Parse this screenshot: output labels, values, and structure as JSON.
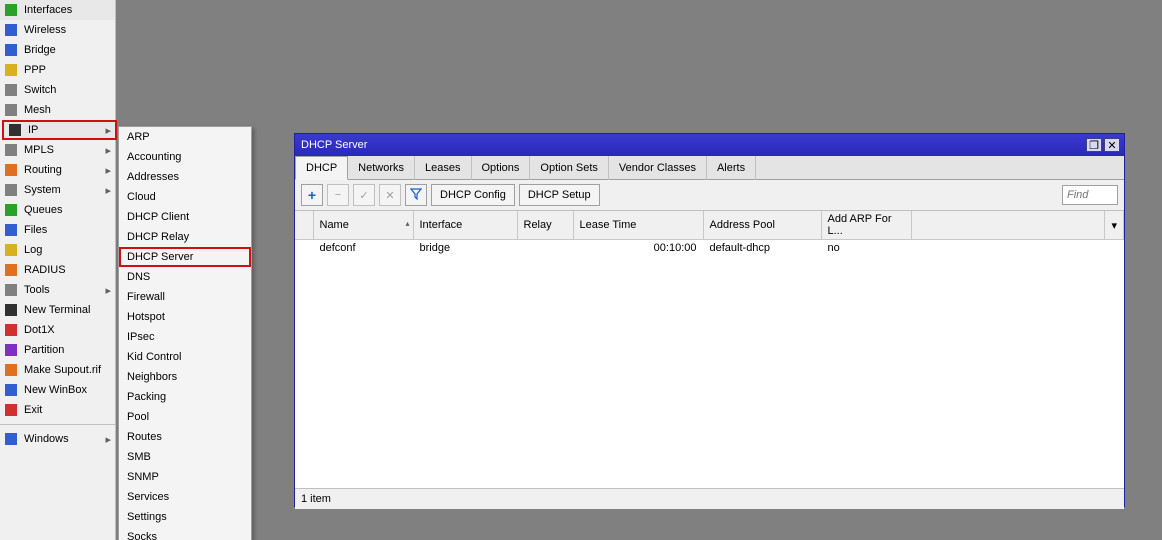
{
  "sidebar": {
    "items": [
      {
        "label": "Interfaces",
        "icon": "interfaces-icon",
        "color": "ic-green",
        "arrow": false
      },
      {
        "label": "Wireless",
        "icon": "wireless-icon",
        "color": "ic-blue",
        "arrow": false
      },
      {
        "label": "Bridge",
        "icon": "bridge-icon",
        "color": "ic-blue",
        "arrow": false
      },
      {
        "label": "PPP",
        "icon": "ppp-icon",
        "color": "ic-yellow",
        "arrow": false
      },
      {
        "label": "Switch",
        "icon": "switch-icon",
        "color": "ic-gray",
        "arrow": false
      },
      {
        "label": "Mesh",
        "icon": "mesh-icon",
        "color": "ic-gray",
        "arrow": false
      },
      {
        "label": "IP",
        "icon": "ip-icon",
        "color": "ic-black",
        "arrow": true,
        "highlighted": true,
        "selected": true
      },
      {
        "label": "MPLS",
        "icon": "mpls-icon",
        "color": "ic-gray",
        "arrow": true
      },
      {
        "label": "Routing",
        "icon": "routing-icon",
        "color": "ic-orange",
        "arrow": true
      },
      {
        "label": "System",
        "icon": "system-icon",
        "color": "ic-gray",
        "arrow": true
      },
      {
        "label": "Queues",
        "icon": "queues-icon",
        "color": "ic-green",
        "arrow": false
      },
      {
        "label": "Files",
        "icon": "files-icon",
        "color": "ic-blue",
        "arrow": false
      },
      {
        "label": "Log",
        "icon": "log-icon",
        "color": "ic-yellow",
        "arrow": false
      },
      {
        "label": "RADIUS",
        "icon": "radius-icon",
        "color": "ic-orange",
        "arrow": false
      },
      {
        "label": "Tools",
        "icon": "tools-icon",
        "color": "ic-gray",
        "arrow": true
      },
      {
        "label": "New Terminal",
        "icon": "new-terminal-icon",
        "color": "ic-black",
        "arrow": false
      },
      {
        "label": "Dot1X",
        "icon": "dot1x-icon",
        "color": "ic-red",
        "arrow": false
      },
      {
        "label": "Partition",
        "icon": "partition-icon",
        "color": "ic-purple",
        "arrow": false
      },
      {
        "label": "Make Supout.rif",
        "icon": "supout-icon",
        "color": "ic-orange",
        "arrow": false
      },
      {
        "label": "New WinBox",
        "icon": "new-winbox-icon",
        "color": "ic-blue",
        "arrow": false
      },
      {
        "label": "Exit",
        "icon": "exit-icon",
        "color": "ic-red",
        "arrow": false
      }
    ],
    "divider_after": 20,
    "windows_label": "Windows",
    "windows_icon": "windows-icon"
  },
  "submenu": {
    "items": [
      {
        "label": "ARP"
      },
      {
        "label": "Accounting"
      },
      {
        "label": "Addresses"
      },
      {
        "label": "Cloud"
      },
      {
        "label": "DHCP Client"
      },
      {
        "label": "DHCP Relay"
      },
      {
        "label": "DHCP Server",
        "highlighted": true
      },
      {
        "label": "DNS"
      },
      {
        "label": "Firewall"
      },
      {
        "label": "Hotspot"
      },
      {
        "label": "IPsec"
      },
      {
        "label": "Kid Control"
      },
      {
        "label": "Neighbors"
      },
      {
        "label": "Packing"
      },
      {
        "label": "Pool"
      },
      {
        "label": "Routes"
      },
      {
        "label": "SMB"
      },
      {
        "label": "SNMP"
      },
      {
        "label": "Services"
      },
      {
        "label": "Settings"
      },
      {
        "label": "Socks"
      }
    ]
  },
  "window": {
    "title": "DHCP Server",
    "tabs": [
      {
        "label": "DHCP",
        "active": true
      },
      {
        "label": "Networks"
      },
      {
        "label": "Leases"
      },
      {
        "label": "Options"
      },
      {
        "label": "Option Sets"
      },
      {
        "label": "Vendor Classes"
      },
      {
        "label": "Alerts"
      }
    ],
    "toolbar": {
      "add": "+",
      "remove": "−",
      "enable": "✓",
      "disable": "✕",
      "filter": "▼",
      "dhcp_config": "DHCP Config",
      "dhcp_setup": "DHCP Setup",
      "find_placeholder": "Find"
    },
    "columns": [
      {
        "header": "Name",
        "sort": "▴"
      },
      {
        "header": "Interface"
      },
      {
        "header": "Relay"
      },
      {
        "header": "Lease Time"
      },
      {
        "header": "Address Pool"
      },
      {
        "header": "Add ARP For L..."
      }
    ],
    "rows": [
      {
        "name": "defconf",
        "interface": "bridge",
        "relay": "",
        "lease_time": "00:10:00",
        "address_pool": "default-dhcp",
        "add_arp": "no"
      }
    ],
    "status": "1 item"
  }
}
